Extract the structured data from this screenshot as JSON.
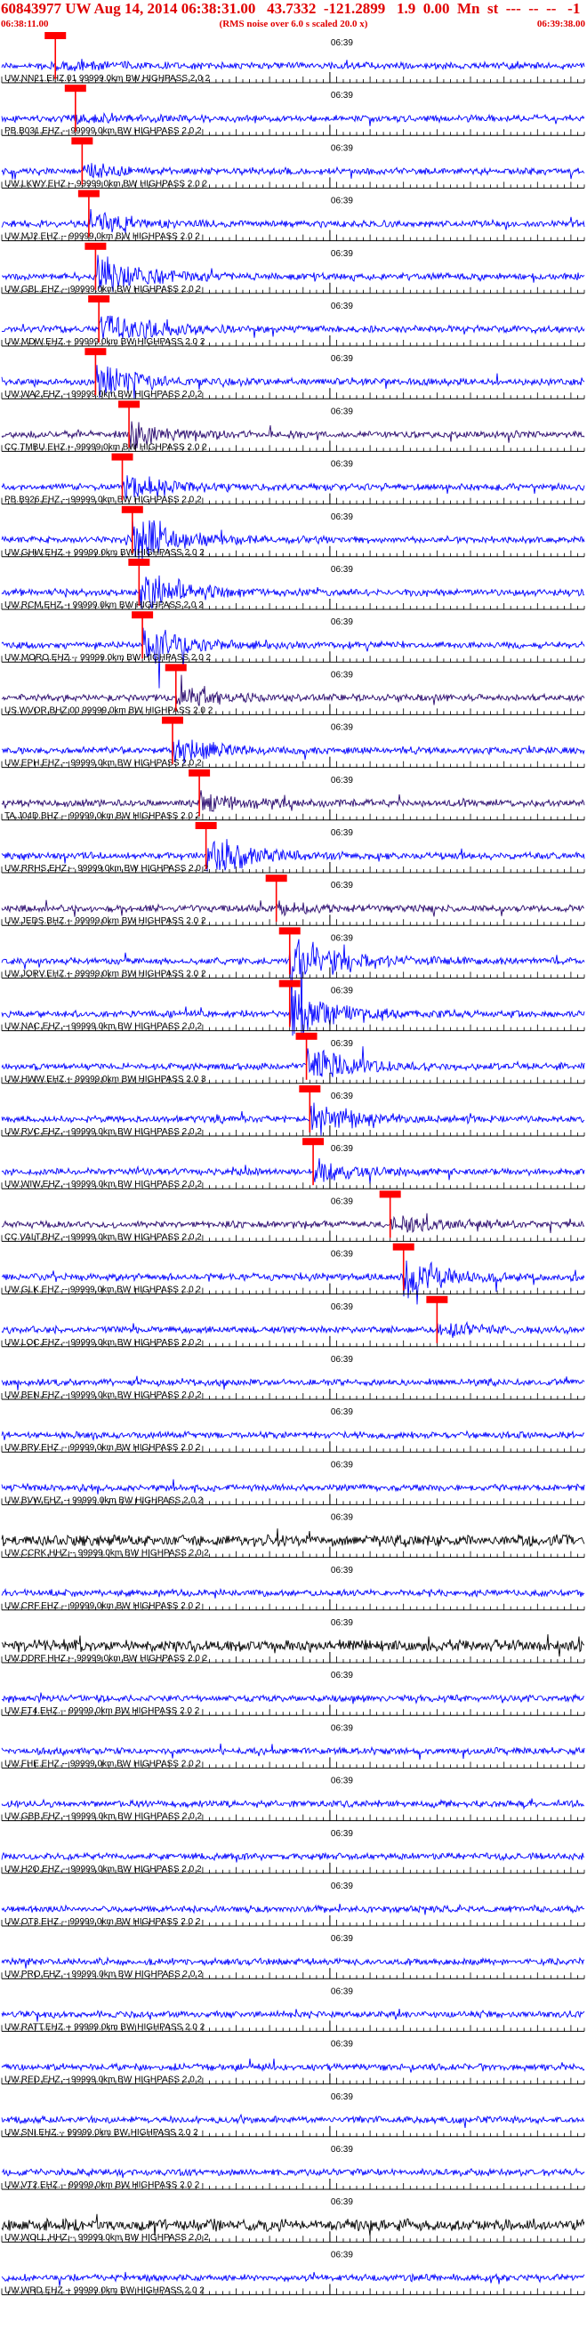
{
  "header": {
    "title": "60843977 UW Aug 14, 2014 06:38:31.00   43.7332  -121.2899   1.9  0.00  Mn  st  ---  --  --   -1",
    "start_time": "06:38:11.00",
    "note": "(RMS noise over 6.0 s scaled 20.0 x)",
    "end_time": "06:39:38.00"
  },
  "chart_data": {
    "type": "line",
    "title": "60843977 UW Aug 14, 2014 06:38:31.00   43.7332  -121.2899   1.9  0.00  Mn  st  ---  --  --   -1",
    "x_range_seconds": [
      0,
      87
    ],
    "x_start": "06:38:11.00",
    "x_end": "06:39:38.00",
    "minute_mark": {
      "label": "06:39",
      "t": 49
    },
    "colors": {
      "trace": "#0000ff",
      "trace_dark": "#000000",
      "trace_purple": "#2a0a6e",
      "pick": "#ff0000",
      "text": "#000000"
    },
    "traces": [
      {
        "name": "UW.NN21.EHZ.01 99999.0km BW HIGHPASS 2.0 2",
        "pick": 8.0,
        "color": "blue",
        "event_amp": 0.15
      },
      {
        "name": "PB.B031.EHZ.-- 99999.0km BW HIGHPASS 2.0 2",
        "pick": 11.0,
        "color": "blue",
        "event_amp": 0.2
      },
      {
        "name": "UW.LKWY.EHZ.-- 99999.0km BW HIGHPASS 2.0 2",
        "pick": 12.0,
        "color": "blue",
        "event_amp": 0.3
      },
      {
        "name": "UW.MJ2.EHZ.-- 99999.0km BW HIGHPASS 2.0 2",
        "pick": 13.0,
        "color": "blue",
        "event_amp": 0.5
      },
      {
        "name": "UW.GBL.EHZ.-- 99999.0km BW HIGHPASS 2.0 2",
        "pick": 14.0,
        "color": "blue",
        "event_amp": 1.0
      },
      {
        "name": "UW.MDW.EHZ.-- 99999.0km BW HIGHPASS 2.0 2",
        "pick": 14.5,
        "color": "blue",
        "event_amp": 0.9
      },
      {
        "name": "UW.WA2.EHZ.-- 99999.0km BW HIGHPASS 2.0 2",
        "pick": 14.0,
        "color": "blue",
        "event_amp": 0.8
      },
      {
        "name": "CC.TMBU.EHZ.-- 99999.0km BW HIGHPASS 2.0 2",
        "pick": 19.0,
        "color": "purple",
        "event_amp": 0.6
      },
      {
        "name": "PB.B926.EHZ.-- 99999.0km BW HIGHPASS 2.0 2",
        "pick": 18.0,
        "color": "blue",
        "event_amp": 0.7
      },
      {
        "name": "UW.GHW.EHZ.-- 99999.0km BW HIGHPASS 2.0 2",
        "pick": 19.5,
        "color": "blue",
        "event_amp": 1.2
      },
      {
        "name": "UW.RCM.EHZ.-- 99999.0km BW HIGHPASS 2.0 2",
        "pick": 20.5,
        "color": "blue",
        "event_amp": 1.0
      },
      {
        "name": "UW.MORO.EHZ.-- 99999.0km BW HIGHPASS 2.0 2",
        "pick": 21.0,
        "color": "blue",
        "event_amp": 0.9
      },
      {
        "name": "US.WVOR.BHZ.00 99999.0km BW HIGHPASS 2.0 2",
        "pick": 26.0,
        "color": "purple",
        "event_amp": 0.5
      },
      {
        "name": "UW.EPH.EHZ.-- 99999.0km BW HIGHPASS 2.0 2",
        "pick": 25.5,
        "color": "blue",
        "event_amp": 0.6
      },
      {
        "name": "TA.J04D.BHZ.-- 99999.0km BW HIGHPASS 2.0 2",
        "pick": 29.5,
        "color": "purple",
        "event_amp": 0.4
      },
      {
        "name": "UW.RRHS.EHZ.-- 99999.0km BW HIGHPASS 2.0 2",
        "pick": 30.5,
        "color": "blue",
        "event_amp": 1.0
      },
      {
        "name": "UW.JEDS.BHZ.-- 99999.0km BW HIGHPASS 2.0 2",
        "pick": 41.0,
        "color": "purple",
        "event_amp": 0.2
      },
      {
        "name": "UW.JORV.EHZ.-- 99999.0km BW HIGHPASS 2.0 2",
        "pick": 43.0,
        "color": "blue",
        "event_amp": 1.5
      },
      {
        "name": "UW.NAC.EHZ.-- 99999.0km BW HIGHPASS 2.0 2",
        "pick": 43.0,
        "color": "blue",
        "event_amp": 1.2
      },
      {
        "name": "UW.HWW.EHZ.-- 99999.0km BW HIGHPASS 2.0 3",
        "pick": 45.5,
        "color": "blue",
        "event_amp": 0.8
      },
      {
        "name": "UW.RVC.EHZ.-- 99999.0km BW HIGHPASS 2.0 2",
        "pick": 46.0,
        "color": "blue",
        "event_amp": 0.7
      },
      {
        "name": "UW.WIW.EHZ.-- 99999.0km BW HIGHPASS 2.0 2",
        "pick": 46.5,
        "color": "blue",
        "event_amp": 0.5
      },
      {
        "name": "CC.VALT.BHZ.-- 99999.0km BW HIGHPASS 2.0 2",
        "pick": 58.0,
        "color": "purple",
        "event_amp": 0.4
      },
      {
        "name": "UW.GLK.EHZ.-- 99999.0km BW HIGHPASS 2.0 2",
        "pick": 60.0,
        "color": "blue",
        "event_amp": 0.8
      },
      {
        "name": "UW.LOC.EHZ.-- 99999.0km BW HIGHPASS 2.0 2",
        "pick": 65.0,
        "color": "blue",
        "event_amp": 0.3
      },
      {
        "name": "UW.BEN.EHZ.-- 99999.0km BW HIGHPASS 2.0 2",
        "pick": null,
        "color": "blue",
        "event_amp": 0
      },
      {
        "name": "UW.BRV.EHZ.-- 99999.0km BW HIGHPASS 2.0 2",
        "pick": null,
        "color": "blue",
        "event_amp": 0
      },
      {
        "name": "UW.BVW.EHZ.-- 99999.0km BW HIGHPASS 2.0 2",
        "pick": null,
        "color": "blue",
        "event_amp": 0
      },
      {
        "name": "UW.CCRK.HHZ.-- 99999.0km BW HIGHPASS 2.0 2",
        "pick": null,
        "color": "black",
        "event_amp": 0
      },
      {
        "name": "UW.CRF.EHZ.-- 99999.0km BW HIGHPASS 2.0 2",
        "pick": null,
        "color": "blue",
        "event_amp": 0
      },
      {
        "name": "UW.DDRF.HHZ.-- 99999.0km BW HIGHPASS 2.0 2",
        "pick": null,
        "color": "black",
        "event_amp": 0
      },
      {
        "name": "UW.ET4.EHZ.-- 99999.0km BW HIGHPASS 2.0 2",
        "pick": null,
        "color": "blue",
        "event_amp": 0
      },
      {
        "name": "UW.FHE.EHZ.-- 99999.0km BW HIGHPASS 2.0 2",
        "pick": null,
        "color": "blue",
        "event_amp": 0
      },
      {
        "name": "UW.GBB.EHZ.-- 99999.0km BW HIGHPASS 2.0 2",
        "pick": null,
        "color": "blue",
        "event_amp": 0
      },
      {
        "name": "UW.H2O.EHZ.-- 99999.0km BW HIGHPASS 2.0 2",
        "pick": null,
        "color": "blue",
        "event_amp": 0
      },
      {
        "name": "UW.OT3.EHZ.-- 99999.0km BW HIGHPASS 2.0 2",
        "pick": null,
        "color": "blue",
        "event_amp": 0
      },
      {
        "name": "UW.PRO.EHZ.-- 99999.0km BW HIGHPASS 2.0 2",
        "pick": null,
        "color": "blue",
        "event_amp": 0
      },
      {
        "name": "UW.RATT.EHZ.-- 99999.0km BW HIGHPASS 2.0 2",
        "pick": null,
        "color": "blue",
        "event_amp": 0
      },
      {
        "name": "UW.RED.EHZ.-- 99999.0km BW HIGHPASS 2.0 2",
        "pick": null,
        "color": "blue",
        "event_amp": 0
      },
      {
        "name": "UW.SNI.EHZ.-- 99999.0km BW HIGHPASS 2.0 2",
        "pick": null,
        "color": "blue",
        "event_amp": 0
      },
      {
        "name": "UW.VT2.EHZ.-- 99999.0km BW HIGHPASS 2.0 2",
        "pick": null,
        "color": "blue",
        "event_amp": 0
      },
      {
        "name": "UW.WOLL.HHZ.-- 99999.0km BW HIGHPASS 2.0 2",
        "pick": null,
        "color": "black",
        "event_amp": 0
      },
      {
        "name": "UW.WRD.EHZ.-- 99999.0km BW HIGHPASS 2.0 2",
        "pick": null,
        "color": "blue",
        "event_amp": 0
      }
    ]
  }
}
